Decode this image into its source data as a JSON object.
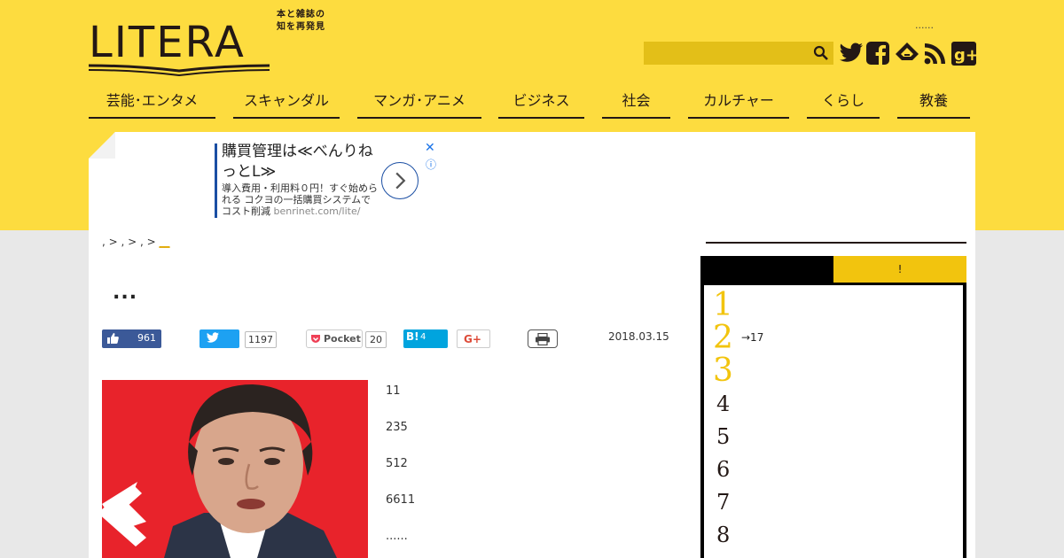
{
  "brand": {
    "logo_text": "LITERA",
    "tagline_1": "本と雑誌の",
    "tagline_2": "知を再発見"
  },
  "header": {
    "dots": "......",
    "search_placeholder": ""
  },
  "nav": {
    "items": [
      "芸能･エンタメ",
      "スキャンダル",
      "マンガ･アニメ",
      "ビジネス",
      "社会",
      "カルチャー",
      "くらし",
      "教養"
    ]
  },
  "ad": {
    "title": "購買管理は≪べんりねっとL≫",
    "desc": "導入費用・利用料０円！すぐ始められる コクヨの一括購買システムでコスト削減",
    "url": "benrinet.com/lite/",
    "close": "✕",
    "info": "ⓘ"
  },
  "breadcrumb": {
    "text": ", > , > , > ",
    "current": "__"
  },
  "article": {
    "title": "...",
    "date": "2018.03.15",
    "paragraphs": [
      "11",
      "235",
      "512",
      "6611",
      "......"
    ]
  },
  "share": {
    "facebook_count": "961",
    "twitter_count": "1197",
    "pocket_label": "Pocket",
    "pocket_count": "20",
    "hatena_label": "B!",
    "hatena_count": "4",
    "gplus_label": "G+"
  },
  "sidebar": {
    "tab_active": "",
    "tab_inactive": "!",
    "ranking": [
      "1",
      "2",
      "3",
      "4",
      "5",
      "6",
      "7",
      "8"
    ],
    "rank_note": "→17"
  },
  "colors": {
    "brand_yellow": "#fddc3f",
    "accent_yellow": "#f2c40e",
    "facebook": "#3b5998",
    "twitter": "#1da1f2",
    "hatena": "#00a4de"
  }
}
